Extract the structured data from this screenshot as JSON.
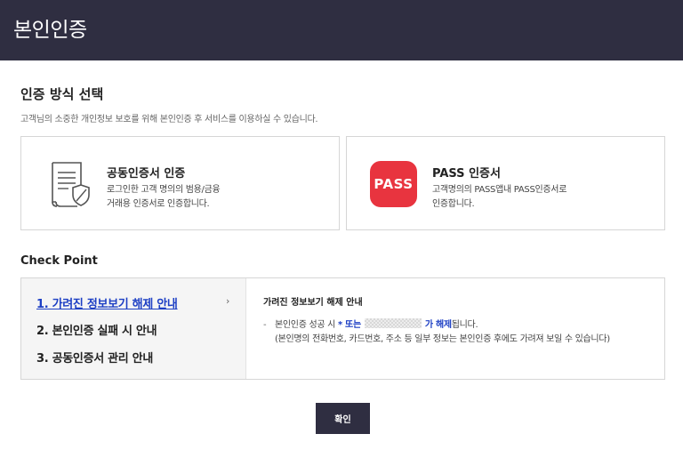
{
  "header": {
    "title": "본인인증"
  },
  "auth_method": {
    "title": "인증 방식 선택",
    "description": "고객님의 소중한 개인정보 보호를 위해 본인인증 후 서비스를 이용하실 수 있습니다."
  },
  "cards": [
    {
      "icon": "certificate-document-icon",
      "title": "공동인증서 인증",
      "desc_line1": "로그인한 고객 명의의 범용/금융",
      "desc_line2": "거래용 인증서로 인증합니다."
    },
    {
      "icon": "pass-logo",
      "logo_text": "PASS",
      "title": "PASS 인증서",
      "desc_line1": "고객명의의 PASS앱내 PASS인증서로",
      "desc_line2": "인증합니다."
    }
  ],
  "checkpoint": {
    "title": "Check Point",
    "menu": [
      {
        "label": "1. 가려진 정보보기 해제 안내",
        "active": true
      },
      {
        "label": "2. 본인인증 실패 시 안내",
        "active": false
      },
      {
        "label": "3. 공동인증서 관리 안내",
        "active": false
      }
    ],
    "chevron": "›",
    "content": {
      "heading": "가려진 정보보기 해제 안내",
      "bullet": "-",
      "line1_prefix": "본인인증 성공 시 ",
      "line1_highlight1": "* 또는",
      "line1_highlight2": "가 해제",
      "line1_suffix": "됩니다.",
      "line2": "(본인명의 전화번호, 카드번호, 주소 등 일부 정보는 본인인증 후에도 가려져 보일 수 있습니다)"
    }
  },
  "confirm_button": {
    "label": "확인"
  },
  "colors": {
    "header_bg": "#2f2e41",
    "accent_blue": "#1d3fc4",
    "pass_red": "#e8343f"
  }
}
